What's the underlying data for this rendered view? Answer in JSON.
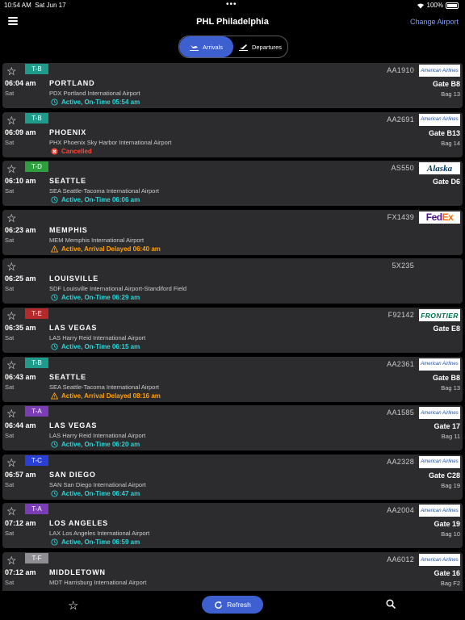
{
  "status_bar": {
    "time": "10:54 AM",
    "date": "Sat Jun 17",
    "battery": "100%",
    "dots": "•••"
  },
  "header": {
    "title": "PHL Philadelphia",
    "change_airport": "Change Airport"
  },
  "segments": {
    "arrivals": "Arrivals",
    "departures": "Departures",
    "selected": "arrivals"
  },
  "colors": {
    "accent": "#3d5fd0",
    "ontime": "#2ed3d6",
    "cancelled": "#ff453a",
    "delayed": "#ff9f0a",
    "T-B": "#1e9b8a",
    "T-D": "#2e9e3e",
    "T-E": "#b42a2a",
    "T-A": "#7a3db5",
    "T-C": "#2a3fd6",
    "T-F": "#8e8e93"
  },
  "flights": [
    {
      "terminal": "T-B",
      "time": "06:04 am",
      "day": "Sat",
      "city": "PORTLAND",
      "airport": "PDX Portland International Airport",
      "status": "Active, On-Time 05:54 am",
      "status_type": "ontime",
      "flight": "AA1910",
      "airline": "American Airlines",
      "airline_logo": "american",
      "gate": "Gate B8",
      "bag": "Bag 13"
    },
    {
      "terminal": "T-B",
      "time": "06:09 am",
      "day": "Sat",
      "city": "PHOENIX",
      "airport": "PHX Phoenix Sky Harbor International Airport",
      "status": "Cancelled",
      "status_type": "cancelled",
      "flight": "AA2691",
      "airline": "American Airlines",
      "airline_logo": "american",
      "gate": "Gate B13",
      "bag": "Bag 14"
    },
    {
      "terminal": "T-D",
      "time": "06:10 am",
      "day": "Sat",
      "city": "SEATTLE",
      "airport": "SEA Seattle-Tacoma International Airport",
      "status": "Active, On-Time 06:06 am",
      "status_type": "ontime",
      "flight": "AS550",
      "airline": "Alaska",
      "airline_logo": "alaska",
      "gate": "Gate D6",
      "bag": ""
    },
    {
      "terminal": "",
      "time": "06:23 am",
      "day": "Sat",
      "city": "MEMPHIS",
      "airport": "MEM Memphis International Airport",
      "status": "Active, Arrival Delayed 06:40 am",
      "status_type": "delayed",
      "flight": "FX1439",
      "airline": "FedEx",
      "airline_logo": "fedex",
      "gate": "",
      "bag": ""
    },
    {
      "terminal": "",
      "time": "06:25 am",
      "day": "Sat",
      "city": "LOUISVILLE",
      "airport": "SDF Louisville International Airport-Standiford Field",
      "status": "Active, On-Time 06:29 am",
      "status_type": "ontime",
      "flight": "5X235",
      "airline": "",
      "airline_logo": "",
      "gate": "",
      "bag": ""
    },
    {
      "terminal": "T-E",
      "time": "06:35 am",
      "day": "Sat",
      "city": "LAS VEGAS",
      "airport": "LAS Harry Reid International Airport",
      "status": "Active, On-Time 06:15 am",
      "status_type": "ontime",
      "flight": "F92142",
      "airline": "FRONTIER",
      "airline_logo": "frontier",
      "gate": "Gate E8",
      "bag": ""
    },
    {
      "terminal": "T-B",
      "time": "06:43 am",
      "day": "Sat",
      "city": "SEATTLE",
      "airport": "SEA Seattle-Tacoma International Airport",
      "status": "Active, Arrival Delayed 08:16 am",
      "status_type": "delayed",
      "flight": "AA2361",
      "airline": "American Airlines",
      "airline_logo": "american",
      "gate": "Gate B8",
      "bag": "Bag 13"
    },
    {
      "terminal": "T-A",
      "time": "06:44 am",
      "day": "Sat",
      "city": "LAS VEGAS",
      "airport": "LAS Harry Reid International Airport",
      "status": "Active, On-Time 06:20 am",
      "status_type": "ontime",
      "flight": "AA1585",
      "airline": "American Airlines",
      "airline_logo": "american",
      "gate": "Gate 17",
      "bag": "Bag 11"
    },
    {
      "terminal": "T-C",
      "time": "06:57 am",
      "day": "Sat",
      "city": "SAN DIEGO",
      "airport": "SAN San Diego International Airport",
      "status": "Active, On-Time 06:47 am",
      "status_type": "ontime",
      "flight": "AA2328",
      "airline": "American Airlines",
      "airline_logo": "american",
      "gate": "Gate C28",
      "bag": "Bag 19"
    },
    {
      "terminal": "T-A",
      "time": "07:12 am",
      "day": "Sat",
      "city": "LOS ANGELES",
      "airport": "LAX Los Angeles International Airport",
      "status": "Active, On-Time 06:59 am",
      "status_type": "ontime",
      "flight": "AA2004",
      "airline": "American Airlines",
      "airline_logo": "american",
      "gate": "Gate 19",
      "bag": "Bag 10"
    },
    {
      "terminal": "T-F",
      "time": "07:12 am",
      "day": "Sat",
      "city": "MIDDLETOWN",
      "airport": "MDT Harrisburg International Airport",
      "status": "",
      "status_type": "ontime",
      "flight": "AA6012",
      "airline": "American Airlines",
      "airline_logo": "american",
      "gate": "Gate 16",
      "bag": "Bag F2"
    }
  ],
  "bottom_bar": {
    "refresh": "Refresh",
    "favorites_icon": "star-icon",
    "search_icon": "search-icon"
  }
}
